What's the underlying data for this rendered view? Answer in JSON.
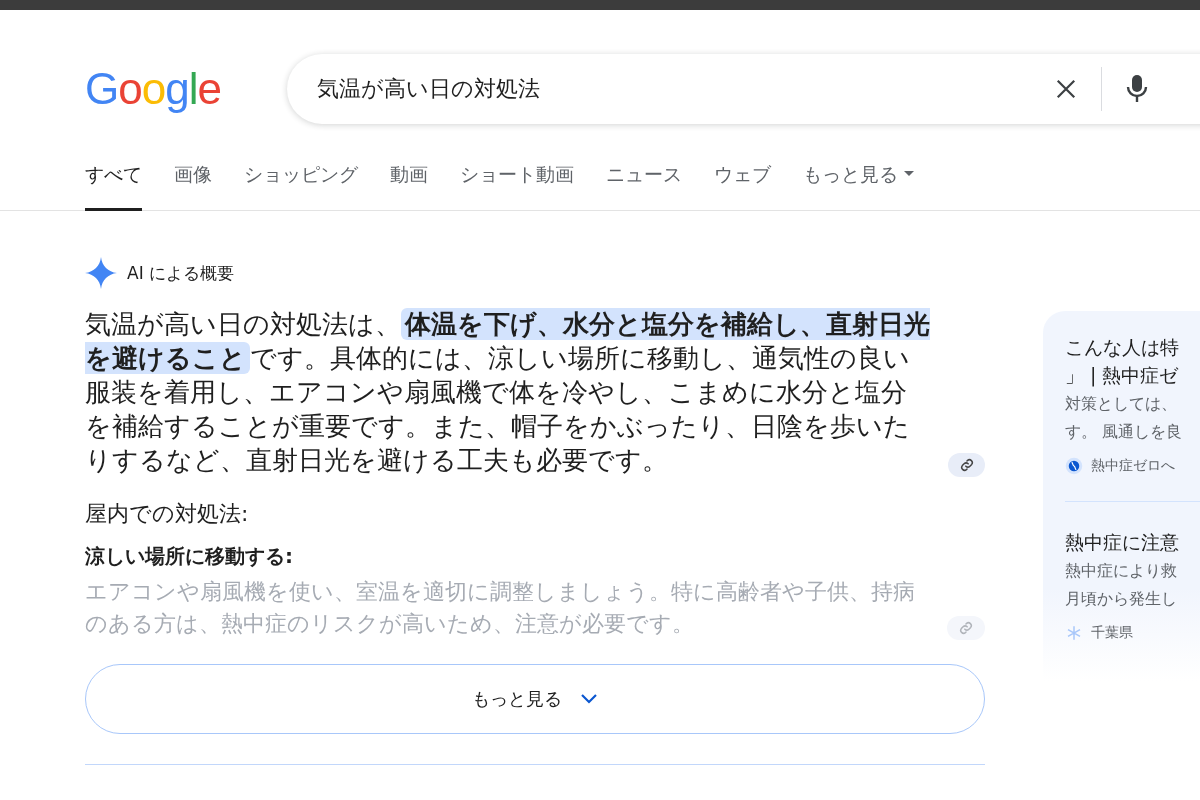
{
  "logo": {
    "letters": [
      {
        "char": "G",
        "color": "#4285f4"
      },
      {
        "char": "o",
        "color": "#ea4335"
      },
      {
        "char": "o",
        "color": "#fbbc05"
      },
      {
        "char": "g",
        "color": "#4285f4"
      },
      {
        "char": "l",
        "color": "#34a853"
      },
      {
        "char": "e",
        "color": "#ea4335"
      }
    ]
  },
  "search": {
    "value": "気温が高い日の対処法"
  },
  "tabs": [
    {
      "label": "すべて",
      "selected": true
    },
    {
      "label": "画像",
      "selected": false
    },
    {
      "label": "ショッピング",
      "selected": false
    },
    {
      "label": "動画",
      "selected": false
    },
    {
      "label": "ショート動画",
      "selected": false
    },
    {
      "label": "ニュース",
      "selected": false
    },
    {
      "label": "ウェブ",
      "selected": false
    },
    {
      "label": "もっと見る",
      "selected": false,
      "kind": "menu"
    }
  ],
  "ai_overview": {
    "title": "AI による概要",
    "summary": "気温が高い日の対処法は、**体温を下げ、水分と塩分を補給し、直射日光を避けること**です。具体的には、涼しい場所に移動し、通気性の良い服装を着用し、エアコンや扇風機で体を冷やし、こまめに水分と塩分を補給することが重要です。また、帽子をかぶったり、日陰を歩いたりするなど、直射日光を避ける工夫も必要です。",
    "section_heading": "屋内での対処法:",
    "items": [
      {
        "heading": "涼しい場所に移動する:",
        "text": "エアコンや扇風機を使い、室温を適切に調整しましょう。特に高齢者や子供、持病のある方は、熱中症のリスクが高いため、注意が必要です。"
      }
    ],
    "more_button": "もっと見る"
  },
  "sources": [
    {
      "title_lines": [
        "こんな人は特",
        "」 | 熱中症ゼ"
      ],
      "snippet_lines": [
        "対策としては、",
        "す。 風通しを良"
      ],
      "site": "熱中症ゼロへ",
      "kind": "globe"
    },
    {
      "title_lines": [
        "熱中症に注意"
      ],
      "snippet_lines": [
        "熱中症により救",
        "月頃から発生し"
      ],
      "site": "千葉県",
      "kind": "asterisk"
    }
  ]
}
